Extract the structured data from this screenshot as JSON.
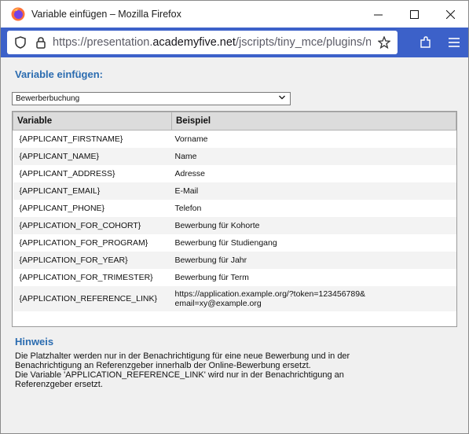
{
  "window": {
    "title": "Variable einfügen – Mozilla Firefox"
  },
  "urlbar": {
    "prefix": "https://presentation.",
    "host": "academyfive.net",
    "path": "/jscripts/tiny_mce/plugins/new"
  },
  "page": {
    "heading": "Variable einfügen:",
    "select_value": "Bewerberbuchung",
    "table": {
      "headers": [
        "Variable",
        "Beispiel"
      ],
      "rows": [
        {
          "variable": "{APPLICANT_FIRSTNAME}",
          "example": "Vorname"
        },
        {
          "variable": "{APPLICANT_NAME}",
          "example": "Name"
        },
        {
          "variable": "{APPLICANT_ADDRESS}",
          "example": "Adresse"
        },
        {
          "variable": "{APPLICANT_EMAIL}",
          "example": "E-Mail"
        },
        {
          "variable": "{APPLICANT_PHONE}",
          "example": "Telefon"
        },
        {
          "variable": "{APPLICATION_FOR_COHORT}",
          "example": "Bewerbung für Kohorte"
        },
        {
          "variable": "{APPLICATION_FOR_PROGRAM}",
          "example": "Bewerbung für Studiengang"
        },
        {
          "variable": "{APPLICATION_FOR_YEAR}",
          "example": "Bewerbung für Jahr"
        },
        {
          "variable": "{APPLICATION_FOR_TRIMESTER}",
          "example": "Bewerbung für Term"
        },
        {
          "variable": "{APPLICATION_REFERENCE_LINK}",
          "example_line1": "https://application.example.org/?token=123456789&",
          "example_line2": "email=xy@example.org"
        }
      ]
    },
    "hint_title": "Hinweis",
    "hint_line1": "Die Platzhalter werden nur in der Benachrichtigung für eine neue Bewerbung und in der",
    "hint_line2": "Benachrichtigung an Referenzgeber innerhalb der Online-Bewerbung ersetzt.",
    "hint_line3": "Die Variable 'APPLICATION_REFERENCE_LINK' wird nur in der Benachrichtigung an",
    "hint_line4": "Referenzgeber ersetzt."
  },
  "colors": {
    "accent": "#3c61c9",
    "heading": "#2b6cb0"
  }
}
